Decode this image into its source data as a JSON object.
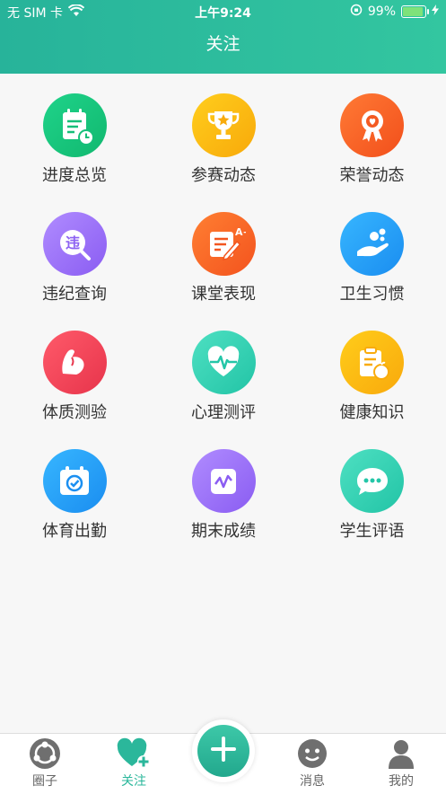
{
  "status": {
    "carrier": "无 SIM 卡",
    "time": "上午9:24",
    "battery": "99%",
    "battery_level": 0.99
  },
  "header": {
    "title": "关注"
  },
  "grid": [
    {
      "label": "进度总览",
      "icon": "progress-calendar-icon",
      "colors": [
        "#1fd38a",
        "#11b86f"
      ]
    },
    {
      "label": "参赛动态",
      "icon": "trophy-icon",
      "colors": [
        "#ffce1d",
        "#f8a90a"
      ]
    },
    {
      "label": "荣誉动态",
      "icon": "award-ribbon-icon",
      "colors": [
        "#ff7a35",
        "#f24f1b"
      ]
    },
    {
      "label": "违纪查询",
      "icon": "violation-search-icon",
      "colors": [
        "#b08cff",
        "#8a5cf2"
      ]
    },
    {
      "label": "课堂表现",
      "icon": "graded-paper-icon",
      "colors": [
        "#ff7f32",
        "#f3531e"
      ]
    },
    {
      "label": "卫生习惯",
      "icon": "hand-bubbles-icon",
      "colors": [
        "#37b6ff",
        "#1a8df0"
      ]
    },
    {
      "label": "体质测验",
      "icon": "muscle-arm-icon",
      "colors": [
        "#ff5a6a",
        "#e7344b"
      ]
    },
    {
      "label": "心理测评",
      "icon": "heartbeat-icon",
      "colors": [
        "#4ee0c2",
        "#22c4a6"
      ]
    },
    {
      "label": "健康知识",
      "icon": "clipboard-apple-icon",
      "colors": [
        "#ffcd1a",
        "#f9a90c"
      ]
    },
    {
      "label": "体育出勤",
      "icon": "calendar-check-icon",
      "colors": [
        "#37b6ff",
        "#1a8df0"
      ]
    },
    {
      "label": "期末成绩",
      "icon": "chart-line-icon",
      "colors": [
        "#b08cff",
        "#8a5cf2"
      ]
    },
    {
      "label": "学生评语",
      "icon": "chat-bubble-icon",
      "colors": [
        "#4ee0c2",
        "#22c4a6"
      ]
    }
  ],
  "tabbar": {
    "circle": "圈子",
    "follow": "关注",
    "messages": "消息",
    "mine": "我的",
    "active": "关注"
  },
  "colors": {
    "accent": "#2bb79b"
  }
}
